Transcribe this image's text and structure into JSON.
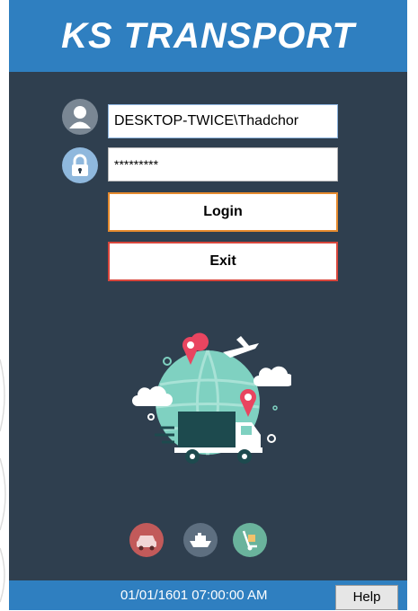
{
  "app": {
    "title": "KS TRANSPORT"
  },
  "login_form": {
    "username_value": "DESKTOP-TWICE\\Thadchor",
    "password_value": "*********",
    "login_label": "Login",
    "exit_label": "Exit"
  },
  "icons": {
    "user": "user-icon",
    "lock": "lock-icon",
    "car": "car-icon",
    "ship": "ship-icon",
    "cart": "cart-icon"
  },
  "status_bar": {
    "datetime": "01/01/1601 07:00:00 AM",
    "help_label": "Help"
  },
  "colors": {
    "header": "#2f7fc0",
    "panel": "#2f3f4f",
    "login_border": "#e58a2e",
    "exit_border": "#d8463c"
  }
}
